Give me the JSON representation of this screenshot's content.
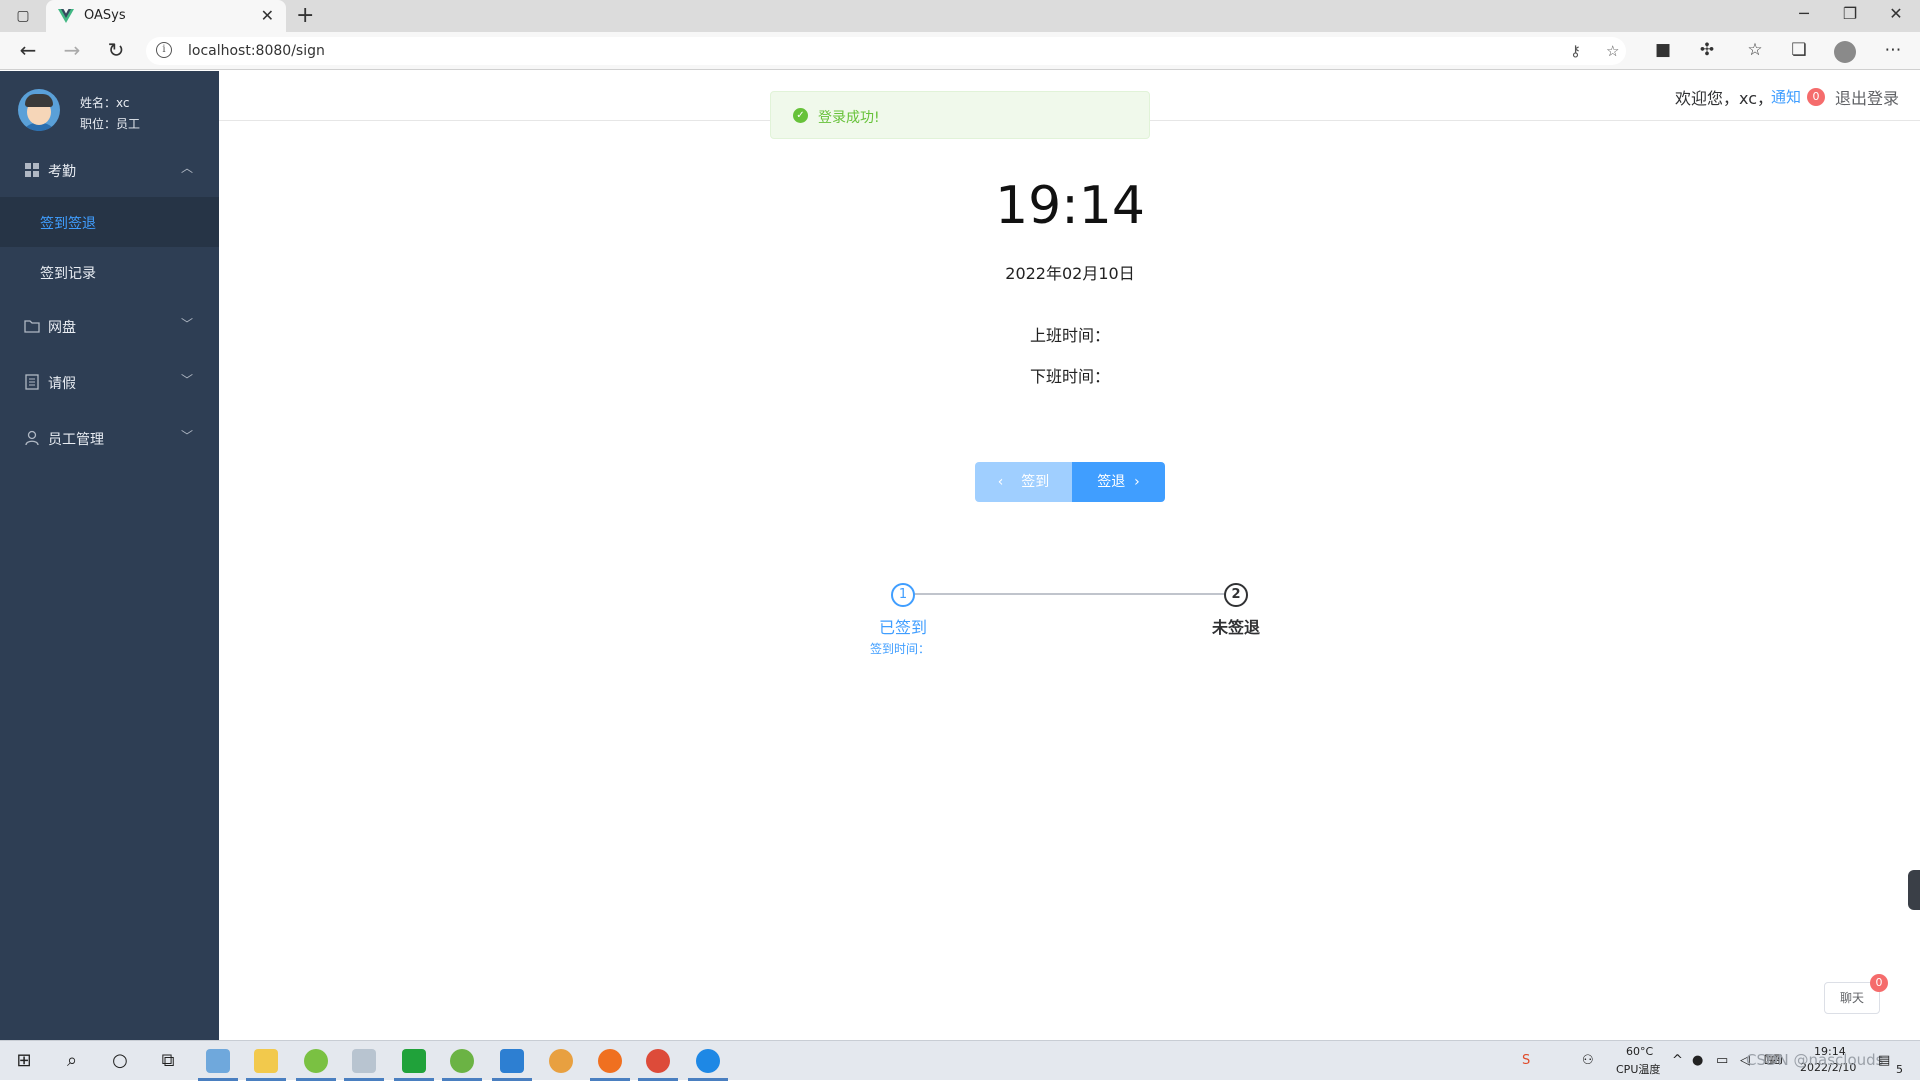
{
  "browser": {
    "tab_title": "OASys",
    "url": "localhost:8080/sign"
  },
  "sidebar": {
    "user_name": "姓名：xc",
    "user_role": "职位：员工",
    "menus": [
      {
        "label": "考勤",
        "icon": "grid-icon",
        "expanded": true,
        "children": [
          {
            "label": "签到签退",
            "active": true
          },
          {
            "label": "签到记录",
            "active": false
          }
        ]
      },
      {
        "label": "网盘",
        "icon": "folder-icon",
        "expanded": false
      },
      {
        "label": "请假",
        "icon": "document-icon",
        "expanded": false
      },
      {
        "label": "员工管理",
        "icon": "user-icon",
        "expanded": false
      }
    ]
  },
  "header": {
    "welcome": "欢迎您，xc，",
    "notify_label": "通知",
    "notify_count": "0",
    "logout_label": "退出登录"
  },
  "toast": {
    "message": "登录成功!",
    "type": "success"
  },
  "attendance": {
    "time": "19:14",
    "date": "2022年02月10日",
    "start_label": "上班时间：",
    "end_label": "下班时间：",
    "sign_in_label": "签到",
    "sign_out_label": "签退",
    "steps": [
      {
        "number": "1",
        "title": "已签到",
        "desc": "签到时间：",
        "status": "done"
      },
      {
        "number": "2",
        "title": "未签退",
        "desc": "",
        "status": "pending"
      }
    ]
  },
  "chat": {
    "label": "聊天",
    "count": "0"
  },
  "taskbar": {
    "temp": "60°C",
    "temp_label": "CPU温度",
    "clock_time": "19:14",
    "clock_date": "2022/2/10",
    "watermark": "CSDN @nasclouds",
    "notification_count": "5"
  },
  "colors": {
    "sidebar_bg": "#2e3e54",
    "accent": "#409eff",
    "success": "#67c23a",
    "danger": "#f56c6c"
  }
}
